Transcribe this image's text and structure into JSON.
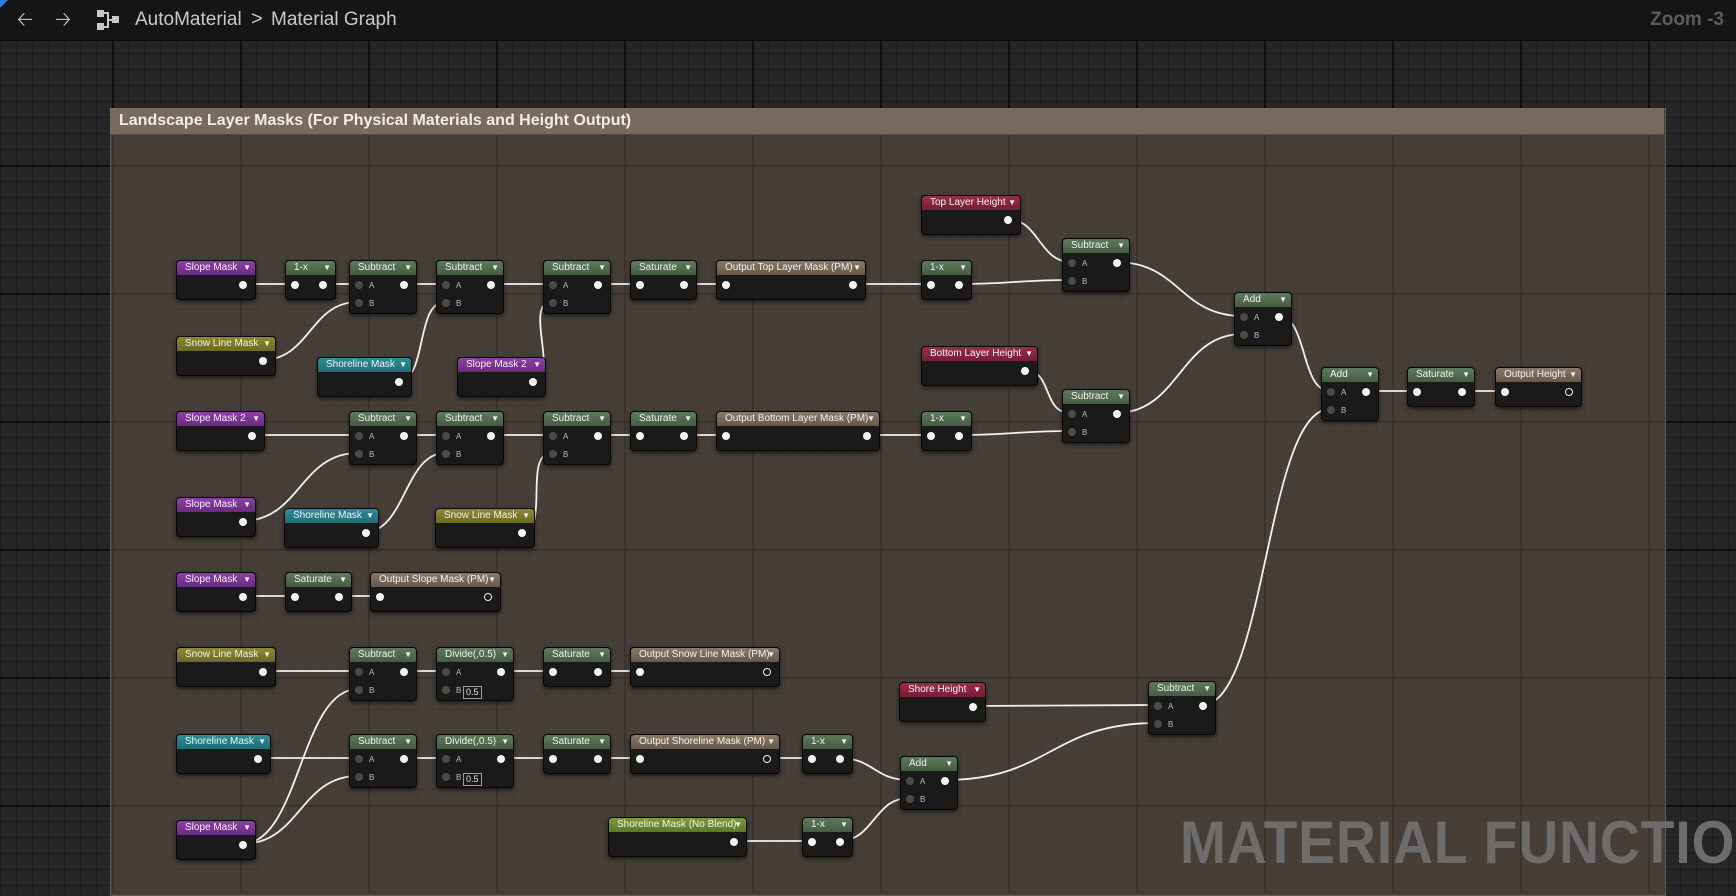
{
  "toolbar": {
    "back_icon": "arrow-left-icon",
    "forward_icon": "arrow-right-icon",
    "graph_icon": "material-graph-icon",
    "breadcrumb_root": "AutoMaterial",
    "breadcrumb_sep": ">",
    "breadcrumb_leaf": "Material Graph",
    "zoom": "Zoom -3"
  },
  "comment": {
    "title": "Landscape Layer Masks (For Physical Materials and Height Output)"
  },
  "watermark": "MATERIAL FUNCTION",
  "colors": {
    "function_input": "#8e3fa8",
    "snow_input": "#8e8a32",
    "shore_input": "#2f8e98",
    "math_node": "#5e7a5c",
    "output_node": "#8a7868",
    "height_param": "#9a2c4c",
    "noblend_input": "#7e9b3a",
    "wire": "#f0f0f0"
  },
  "nodes": [
    {
      "id": "slope1",
      "title": "Slope Mask",
      "kind": "purple"
    },
    {
      "id": "omx1",
      "title": "1-x",
      "kind": "green"
    },
    {
      "id": "sub1",
      "title": "Subtract",
      "kind": "green"
    },
    {
      "id": "sub2",
      "title": "Subtract",
      "kind": "green"
    },
    {
      "id": "sub3",
      "title": "Subtract",
      "kind": "green"
    },
    {
      "id": "sat1",
      "title": "Saturate",
      "kind": "green"
    },
    {
      "id": "outTop",
      "title": "Output Top Layer Mask (PM)",
      "kind": "tan"
    },
    {
      "id": "omx2",
      "title": "1-x",
      "kind": "green"
    },
    {
      "id": "topH",
      "title": "Top Layer Height",
      "kind": "red"
    },
    {
      "id": "subTop",
      "title": "Subtract",
      "kind": "green"
    },
    {
      "id": "snow1",
      "title": "Snow Line Mask",
      "kind": "olive"
    },
    {
      "id": "shore1",
      "title": "Shoreline Mask",
      "kind": "teal"
    },
    {
      "id": "slope2b",
      "title": "Slope Mask 2",
      "kind": "purple"
    },
    {
      "id": "add1",
      "title": "Add",
      "kind": "green"
    },
    {
      "id": "botH",
      "title": "Bottom Layer Height",
      "kind": "red"
    },
    {
      "id": "add2",
      "title": "Add",
      "kind": "green"
    },
    {
      "id": "satH",
      "title": "Saturate",
      "kind": "green"
    },
    {
      "id": "outH",
      "title": "Output Height",
      "kind": "tan"
    },
    {
      "id": "slope2a",
      "title": "Slope Mask 2",
      "kind": "purple"
    },
    {
      "id": "sub4",
      "title": "Subtract",
      "kind": "green"
    },
    {
      "id": "sub5",
      "title": "Subtract",
      "kind": "green"
    },
    {
      "id": "sub6",
      "title": "Subtract",
      "kind": "green"
    },
    {
      "id": "sat2",
      "title": "Saturate",
      "kind": "green"
    },
    {
      "id": "outBot",
      "title": "Output Bottom Layer Mask (PM)",
      "kind": "tan"
    },
    {
      "id": "omx3",
      "title": "1-x",
      "kind": "green"
    },
    {
      "id": "subBot",
      "title": "Subtract",
      "kind": "green"
    },
    {
      "id": "slope3",
      "title": "Slope Mask",
      "kind": "purple"
    },
    {
      "id": "shore2",
      "title": "Shoreline Mask",
      "kind": "teal"
    },
    {
      "id": "snow2",
      "title": "Snow Line Mask",
      "kind": "olive"
    },
    {
      "id": "slope4",
      "title": "Slope Mask",
      "kind": "purple"
    },
    {
      "id": "sat3",
      "title": "Saturate",
      "kind": "green"
    },
    {
      "id": "outSlope",
      "title": "Output Slope Mask (PM)",
      "kind": "tan"
    },
    {
      "id": "snow3",
      "title": "Snow Line Mask",
      "kind": "olive"
    },
    {
      "id": "sub7",
      "title": "Subtract",
      "kind": "green"
    },
    {
      "id": "div1",
      "title": "Divide(,0.5)",
      "kind": "green",
      "const": "0.5"
    },
    {
      "id": "sat4",
      "title": "Saturate",
      "kind": "green"
    },
    {
      "id": "outSnow",
      "title": "Output Snow Line Mask (PM)",
      "kind": "tan"
    },
    {
      "id": "shoreH",
      "title": "Shore Height",
      "kind": "red"
    },
    {
      "id": "subShore",
      "title": "Subtract",
      "kind": "green"
    },
    {
      "id": "shore3",
      "title": "Shoreline Mask",
      "kind": "teal"
    },
    {
      "id": "sub8",
      "title": "Subtract",
      "kind": "green"
    },
    {
      "id": "div2",
      "title": "Divide(,0.5)",
      "kind": "green",
      "const": "0.5"
    },
    {
      "id": "sat5",
      "title": "Saturate",
      "kind": "green"
    },
    {
      "id": "outShore",
      "title": "Output Shoreline Mask (PM)",
      "kind": "tan"
    },
    {
      "id": "omx4",
      "title": "1-x",
      "kind": "green"
    },
    {
      "id": "add3",
      "title": "Add",
      "kind": "green"
    },
    {
      "id": "shoreNB",
      "title": "Shoreline Mask (No Blend)",
      "kind": "lime"
    },
    {
      "id": "omx5",
      "title": "1-x",
      "kind": "green"
    },
    {
      "id": "slope5",
      "title": "Slope Mask",
      "kind": "purple"
    }
  ],
  "pin_labels": {
    "a": "A",
    "b": "B"
  },
  "wires": [
    [
      "slope1",
      "out",
      "omx1",
      "in"
    ],
    [
      "omx1",
      "out",
      "sub1",
      "a"
    ],
    [
      "snow1",
      "out",
      "sub1",
      "b"
    ],
    [
      "sub1",
      "out",
      "sub2",
      "a"
    ],
    [
      "shore1",
      "out",
      "sub2",
      "b"
    ],
    [
      "sub2",
      "out",
      "sub3",
      "a"
    ],
    [
      "slope2b",
      "out",
      "sub3",
      "b"
    ],
    [
      "sub3",
      "out",
      "sat1",
      "in"
    ],
    [
      "sat1",
      "out",
      "outTop",
      "in"
    ],
    [
      "outTop",
      "out",
      "omx2",
      "in"
    ],
    [
      "omx2",
      "out",
      "subTop",
      "b"
    ],
    [
      "topH",
      "out",
      "subTop",
      "a"
    ],
    [
      "subTop",
      "out",
      "add1",
      "a"
    ],
    [
      "subBot",
      "out",
      "add1",
      "b"
    ],
    [
      "add1",
      "out",
      "add2",
      "a"
    ],
    [
      "subShore",
      "out",
      "add2",
      "b"
    ],
    [
      "add2",
      "out",
      "satH",
      "in"
    ],
    [
      "satH",
      "out",
      "outH",
      "in"
    ],
    [
      "slope2a",
      "out",
      "sub4",
      "a"
    ],
    [
      "slope3",
      "out",
      "sub4",
      "b"
    ],
    [
      "sub4",
      "out",
      "sub5",
      "a"
    ],
    [
      "shore2",
      "out",
      "sub5",
      "b"
    ],
    [
      "sub5",
      "out",
      "sub6",
      "a"
    ],
    [
      "snow2",
      "out",
      "sub6",
      "b"
    ],
    [
      "sub6",
      "out",
      "sat2",
      "in"
    ],
    [
      "sat2",
      "out",
      "outBot",
      "in"
    ],
    [
      "outBot",
      "out",
      "omx3",
      "in"
    ],
    [
      "omx3",
      "out",
      "subBot",
      "b"
    ],
    [
      "botH",
      "out",
      "subBot",
      "a"
    ],
    [
      "slope4",
      "out",
      "sat3",
      "in"
    ],
    [
      "sat3",
      "out",
      "outSlope",
      "in"
    ],
    [
      "snow3",
      "out",
      "sub7",
      "a"
    ],
    [
      "slope5",
      "out",
      "sub7",
      "b"
    ],
    [
      "sub7",
      "out",
      "div1",
      "a"
    ],
    [
      "div1",
      "out",
      "sat4",
      "in"
    ],
    [
      "sat4",
      "out",
      "outSnow",
      "in"
    ],
    [
      "shoreH",
      "out",
      "subShore",
      "a"
    ],
    [
      "add3",
      "out",
      "subShore",
      "b"
    ],
    [
      "shore3",
      "out",
      "sub8",
      "a"
    ],
    [
      "slope5",
      "out",
      "sub8",
      "b"
    ],
    [
      "sub8",
      "out",
      "div2",
      "a"
    ],
    [
      "div2",
      "out",
      "sat5",
      "in"
    ],
    [
      "sat5",
      "out",
      "outShore",
      "in"
    ],
    [
      "outShore",
      "out",
      "omx4",
      "in"
    ],
    [
      "omx4",
      "out",
      "add3",
      "a"
    ],
    [
      "shoreNB",
      "out",
      "omx5",
      "in"
    ],
    [
      "omx5",
      "out",
      "add3",
      "b"
    ]
  ]
}
